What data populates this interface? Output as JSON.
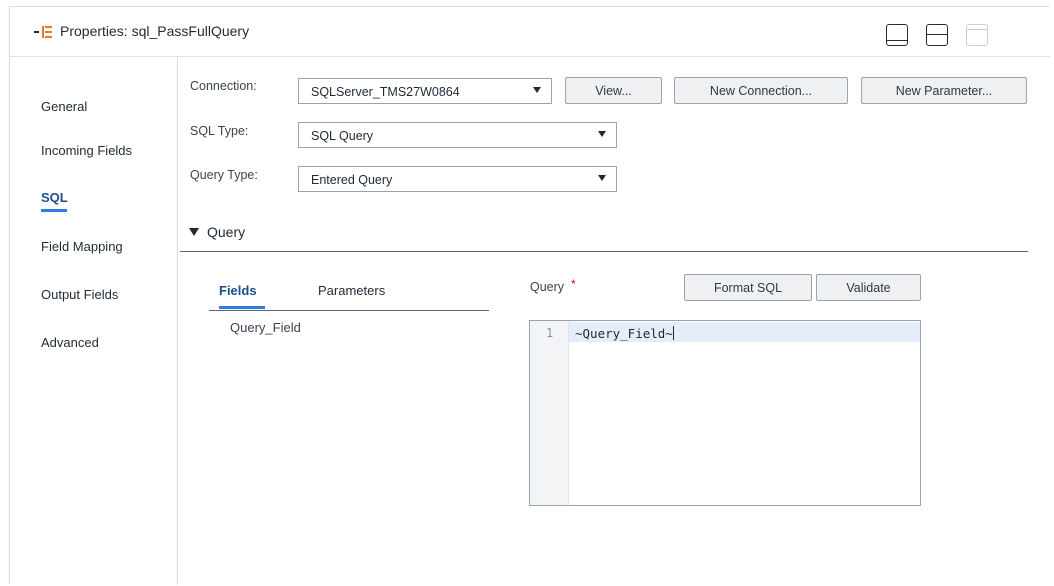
{
  "header": {
    "title": "Properties: sql_PassFullQuery",
    "icon": "properties-icon",
    "layout_buttons": [
      "layout-bottom-panel-icon",
      "layout-split-icon",
      "layout-top-panel-icon"
    ]
  },
  "nav": {
    "items": [
      {
        "label": "General",
        "active": false
      },
      {
        "label": "Incoming Fields",
        "active": false
      },
      {
        "label": "SQL",
        "active": true
      },
      {
        "label": "Field Mapping",
        "active": false
      },
      {
        "label": "Output Fields",
        "active": false
      },
      {
        "label": "Advanced",
        "active": false
      }
    ]
  },
  "form": {
    "connection_label": "Connection:",
    "connection_value": "SQLServer_TMS27W0864",
    "view_button": "View...",
    "new_connection_button": "New Connection...",
    "new_parameter_button": "New Parameter...",
    "sql_type_label": "SQL Type:",
    "sql_type_value": "SQL Query",
    "query_type_label": "Query Type:",
    "query_type_value": "Entered Query"
  },
  "query_section": {
    "title": "Query",
    "tabs": [
      {
        "label": "Fields",
        "active": true
      },
      {
        "label": "Parameters",
        "active": false
      }
    ],
    "fields": [
      "Query_Field"
    ],
    "query_label": "Query",
    "required_mark": "*",
    "format_button": "Format SQL",
    "validate_button": "Validate",
    "editor": {
      "line_number": "1",
      "code": "~Query_Field~"
    }
  },
  "colors": {
    "accent": "#2f7de1",
    "active_text": "#1c4e8c",
    "required": "#d0021b"
  }
}
